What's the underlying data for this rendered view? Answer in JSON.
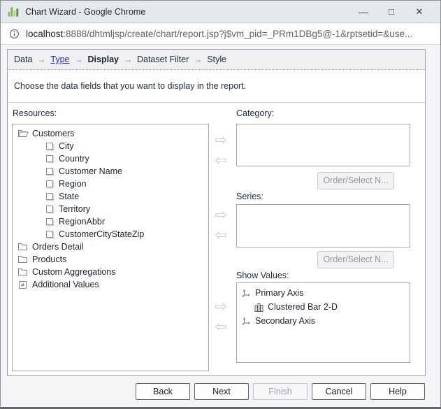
{
  "window": {
    "title": "Chart Wizard - Google Chrome",
    "controls": {
      "minimize": "—",
      "maximize": "□",
      "close": "✕"
    }
  },
  "address_bar": {
    "host": "localhost",
    "rest": ":8888/dhtmljsp/create/chart/report.jsp?j$vm_pid=_PRm1DBg5@-1&rptsetid=&use..."
  },
  "breadcrumb": {
    "separator": "→",
    "steps": [
      {
        "label": "Data"
      },
      {
        "label": "Type"
      },
      {
        "label": "Display"
      },
      {
        "label": "Dataset Filter"
      },
      {
        "label": "Style"
      }
    ]
  },
  "instruction": "Choose the data fields that you want to display in the report.",
  "transfer": {
    "right_arrow": "⇨",
    "left_arrow": "⇦"
  },
  "resources": {
    "label": "Resources:",
    "tree": [
      {
        "label": "Customers",
        "icon": "folder-open-icon",
        "indent": 0
      },
      {
        "label": "City",
        "icon": "field-icon",
        "indent": 1
      },
      {
        "label": "Country",
        "icon": "field-icon",
        "indent": 1
      },
      {
        "label": "Customer Name",
        "icon": "field-icon",
        "indent": 1
      },
      {
        "label": "Region",
        "icon": "field-icon",
        "indent": 1
      },
      {
        "label": "State",
        "icon": "field-icon",
        "indent": 1
      },
      {
        "label": "Territory",
        "icon": "field-icon",
        "indent": 1
      },
      {
        "label": "RegionAbbr",
        "icon": "field-icon",
        "indent": 1
      },
      {
        "label": "CustomerCityStateZip",
        "icon": "field-icon",
        "indent": 1
      },
      {
        "label": "Orders Detail",
        "icon": "folder-icon",
        "indent": 0
      },
      {
        "label": "Products",
        "icon": "folder-icon",
        "indent": 0
      },
      {
        "label": "Custom Aggregations",
        "icon": "folder-icon",
        "indent": 0
      },
      {
        "label": "Additional Values",
        "icon": "number-icon",
        "indent": 0,
        "icon_glyph": "#"
      }
    ]
  },
  "category": {
    "label": "Category:",
    "items": [],
    "order_button_label": "Order/Select N..."
  },
  "series": {
    "label": "Series:",
    "items": [],
    "order_button_label": "Order/Select N..."
  },
  "show_values": {
    "label": "Show Values:",
    "items": [
      {
        "label": "Primary Axis",
        "icon": "axis-icon",
        "indent": 0
      },
      {
        "label": "Clustered Bar 2-D",
        "icon": "bar-chart-icon",
        "indent": 1
      },
      {
        "label": "Secondary Axis",
        "icon": "axis-icon",
        "indent": 0
      }
    ]
  },
  "footer": {
    "buttons": [
      {
        "label": "Back",
        "enabled": true
      },
      {
        "label": "Next",
        "enabled": true
      },
      {
        "label": "Finish",
        "enabled": false
      },
      {
        "label": "Cancel",
        "enabled": true
      },
      {
        "label": "Help",
        "enabled": true
      }
    ]
  },
  "colors": {
    "link_blue": "#2424d6",
    "favicon_green": "#7cb342",
    "titlebar_bg": "#e6e9ec",
    "breadcrumb_bg": "#eef0f2"
  }
}
